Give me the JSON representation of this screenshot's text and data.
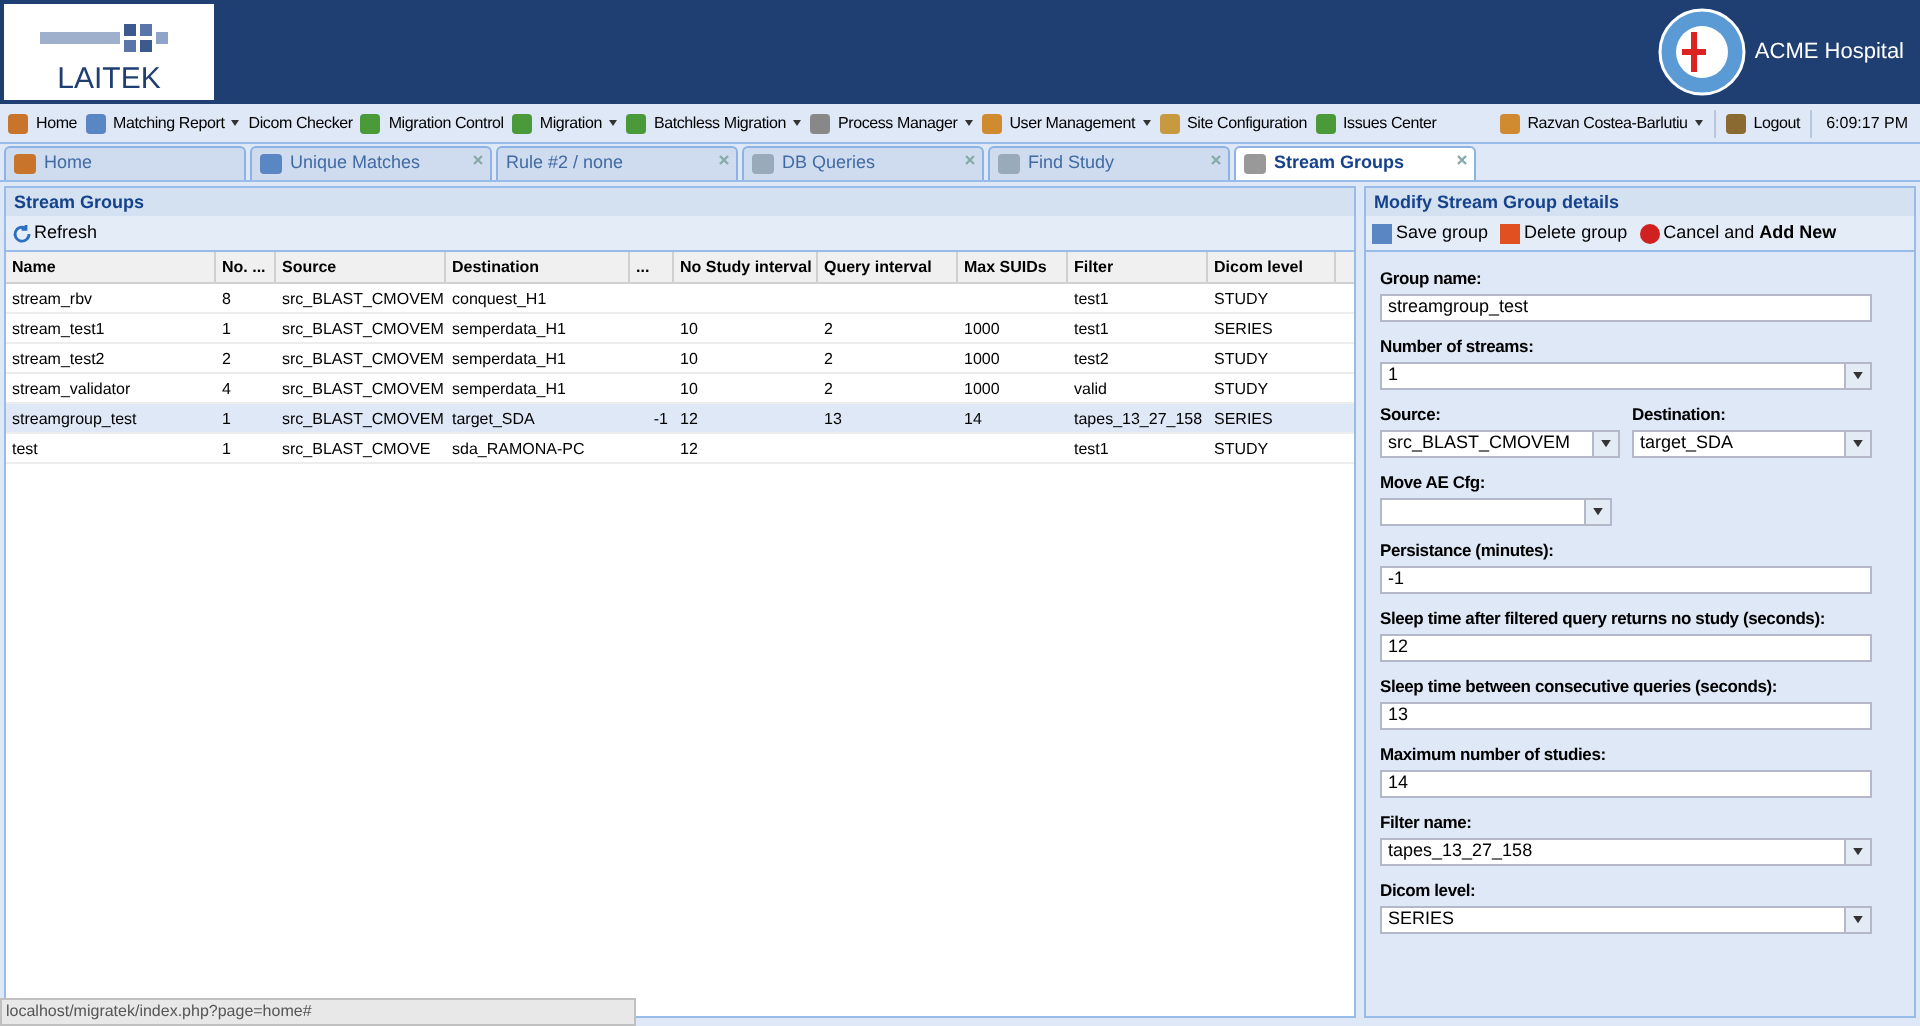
{
  "header": {
    "logo": "LAITEK",
    "hospital": "ACME Hospital"
  },
  "menu": [
    {
      "label": "Home",
      "has_menu": false
    },
    {
      "label": "Matching Report",
      "has_menu": true
    },
    {
      "label": "Dicom Checker",
      "has_menu": false
    },
    {
      "label": "Migration Control",
      "has_menu": false
    },
    {
      "label": "Migration",
      "has_menu": true
    },
    {
      "label": "Batchless Migration",
      "has_menu": true
    },
    {
      "label": "Process Manager",
      "has_menu": true
    },
    {
      "label": "User Management",
      "has_menu": true
    },
    {
      "label": "Site Configuration",
      "has_menu": false
    },
    {
      "label": "Issues Center",
      "has_menu": false
    }
  ],
  "user_menu": [
    {
      "label": "Razvan Costea-Barlutiu",
      "has_menu": true
    },
    {
      "label": "Logout",
      "has_menu": false
    }
  ],
  "clock": "6:09:17 PM",
  "tabs": [
    {
      "label": "Home",
      "selected": false,
      "closable": false
    },
    {
      "label": "Unique Matches",
      "selected": false,
      "closable": true
    },
    {
      "label": "Rule #2 / none",
      "selected": false,
      "closable": true
    },
    {
      "label": "DB Queries",
      "selected": false,
      "closable": true
    },
    {
      "label": "Find Study",
      "selected": false,
      "closable": true
    },
    {
      "label": "Stream Groups",
      "selected": true,
      "closable": true
    }
  ],
  "grid": {
    "title": "Stream Groups",
    "toolbar": [
      "Refresh"
    ],
    "columns": [
      "Name",
      "No. ...",
      "Source",
      "Destination",
      "...",
      "No Study interval",
      "Query interval",
      "Max SUIDs",
      "Filter",
      "Dicom level"
    ],
    "rows": [
      {
        "selected": false,
        "cells": [
          "stream_rbv",
          "8",
          "src_BLAST_CMOVEM",
          "conquest_H1",
          "",
          "",
          "",
          "",
          "test1",
          "STUDY"
        ]
      },
      {
        "selected": false,
        "cells": [
          "stream_test1",
          "1",
          "src_BLAST_CMOVEM",
          "semperdata_H1",
          "",
          "10",
          "2",
          "1000",
          "test1",
          "SERIES"
        ]
      },
      {
        "selected": false,
        "cells": [
          "stream_test2",
          "2",
          "src_BLAST_CMOVEM",
          "semperdata_H1",
          "",
          "10",
          "2",
          "1000",
          "test2",
          "STUDY"
        ]
      },
      {
        "selected": false,
        "cells": [
          "stream_validator",
          "4",
          "src_BLAST_CMOVEM",
          "semperdata_H1",
          "",
          "10",
          "2",
          "1000",
          "valid",
          "STUDY"
        ]
      },
      {
        "selected": true,
        "cells": [
          "streamgroup_test",
          "1",
          "src_BLAST_CMOVEM",
          "target_SDA",
          "-1",
          "12",
          "13",
          "14",
          "tapes_13_27_158",
          "SERIES"
        ]
      },
      {
        "selected": false,
        "cells": [
          "test",
          "1",
          "src_BLAST_CMOVE",
          "sda_RAMONA-PC",
          "",
          "12",
          "",
          "",
          "test1",
          "STUDY"
        ]
      }
    ]
  },
  "form": {
    "title": "Modify Stream Group details",
    "toolbar": [
      {
        "label": "Save group"
      },
      {
        "label": "Delete group"
      },
      {
        "label": "Cancel and **Add New**"
      }
    ],
    "rows": [
      [
        {
          "label": "Group name:",
          "value": "streamgroup_test",
          "kind": "text"
        }
      ],
      [
        {
          "label": "Number of streams:",
          "value": "1",
          "kind": "select"
        }
      ],
      [
        {
          "label": "Source:",
          "value": "src_BLAST_CMOVEM",
          "kind": "select"
        },
        {
          "label": "Destination:",
          "value": "target_SDA",
          "kind": "select"
        }
      ],
      [
        {
          "label": "Move AE Cfg:",
          "kind": "short_select"
        }
      ],
      [
        {
          "label": "Persistance (minutes):",
          "value": "-1",
          "kind": "text"
        }
      ],
      [
        {
          "label": "Sleep time after filtered query returns no study (seconds):",
          "value": "12",
          "kind": "text"
        }
      ],
      [
        {
          "label": "Sleep time between consecutive queries (seconds):",
          "value": "13",
          "kind": "text"
        }
      ],
      [
        {
          "label": "Maximum number of studies:",
          "value": "14",
          "kind": "text"
        }
      ],
      [
        {
          "label": "Filter name:",
          "value": "tapes_13_27_158",
          "kind": "select"
        }
      ],
      [
        {
          "label": "Dicom level:",
          "value": "SERIES",
          "kind": "select"
        }
      ]
    ]
  },
  "status_url": "localhost/migratek/index.php?page=home#"
}
